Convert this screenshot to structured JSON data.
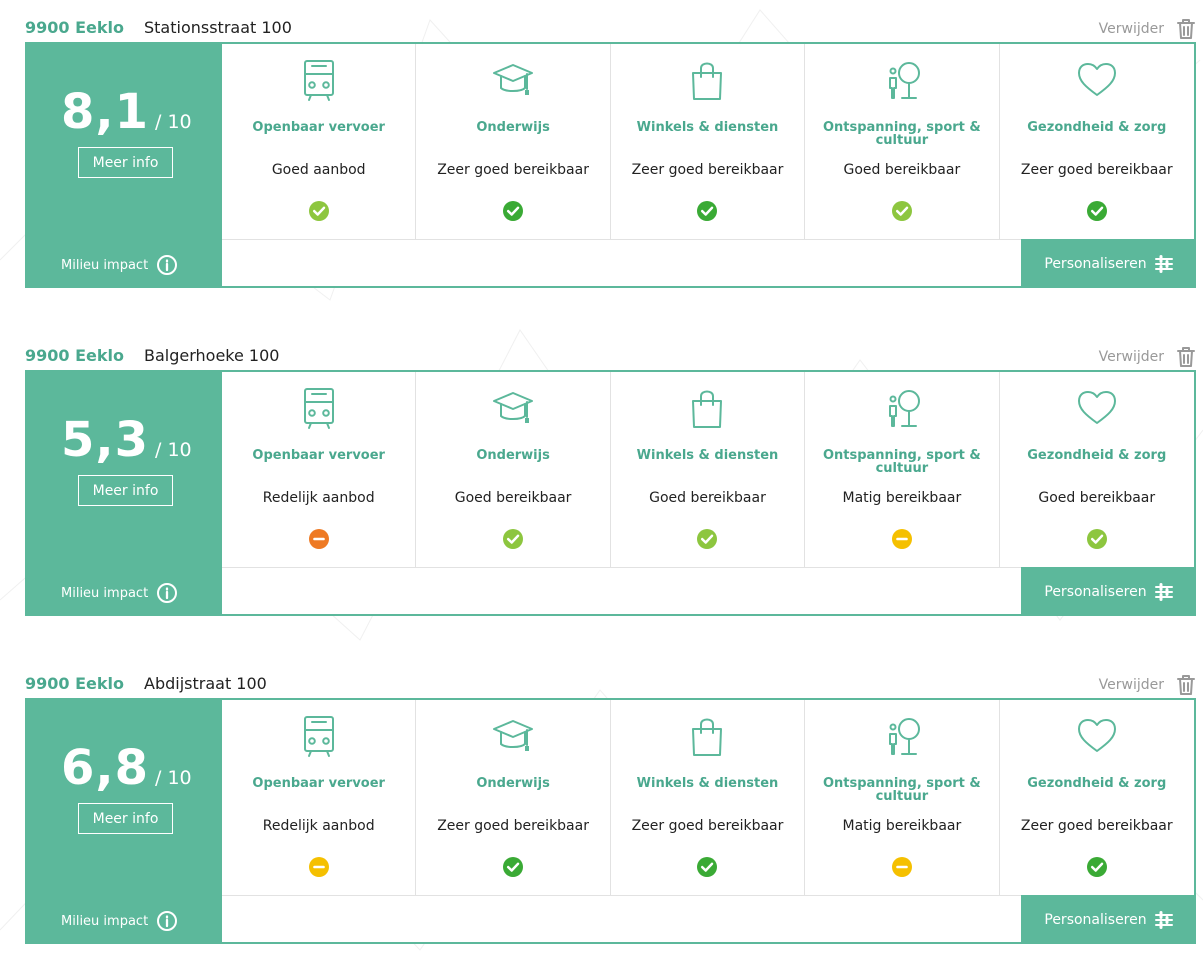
{
  "colors": {
    "brand_green": "#5cb89b",
    "title_green": "#4aa88e",
    "status_good": "#8dc63f",
    "status_very_good": "#3aaa35",
    "status_fair": "#f5c000",
    "status_mixed": "#ee7a24"
  },
  "remove_label": "Verwijder",
  "more_info_label": "Meer info",
  "score_suffix": "/ 10",
  "milieu_label": "Milieu impact",
  "personalize_label": "Personaliseren",
  "category_titles": {
    "transport": "Openbaar vervoer",
    "education": "Onderwijs",
    "shops": "Winkels & diensten",
    "leisure": "Ontspanning, sport & cultuur",
    "health": "Gezondheid & zorg"
  },
  "icons": {
    "transport": "bus-icon",
    "education": "graduation-cap-icon",
    "shops": "shopping-bag-icon",
    "leisure": "park-person-tree-icon",
    "health": "heart-icon",
    "remove": "trash-icon",
    "milieu": "info-icon",
    "personalize": "sliders-icon"
  },
  "cards": [
    {
      "city": "9900 Eeklo",
      "street": "Stationsstraat 100",
      "score": "8,1",
      "categories": [
        {
          "status": "Goed aanbod",
          "badge": "check-good"
        },
        {
          "status": "Zeer goed bereikbaar",
          "badge": "check-very-good"
        },
        {
          "status": "Zeer goed bereikbaar",
          "badge": "check-very-good"
        },
        {
          "status": "Goed bereikbaar",
          "badge": "check-good"
        },
        {
          "status": "Zeer goed bereikbaar",
          "badge": "check-very-good"
        }
      ]
    },
    {
      "city": "9900 Eeklo",
      "street": "Balgerhoeke 100",
      "score": "5,3",
      "categories": [
        {
          "status": "Redelijk aanbod",
          "badge": "minus-orange"
        },
        {
          "status": "Goed bereikbaar",
          "badge": "check-good"
        },
        {
          "status": "Goed bereikbaar",
          "badge": "check-good"
        },
        {
          "status": "Matig bereikbaar",
          "badge": "minus-yellow"
        },
        {
          "status": "Goed bereikbaar",
          "badge": "check-good"
        }
      ]
    },
    {
      "city": "9900 Eeklo",
      "street": "Abdijstraat 100",
      "score": "6,8",
      "categories": [
        {
          "status": "Redelijk aanbod",
          "badge": "minus-yellow"
        },
        {
          "status": "Zeer goed bereikbaar",
          "badge": "check-very-good"
        },
        {
          "status": "Zeer goed bereikbaar",
          "badge": "check-very-good"
        },
        {
          "status": "Matig bereikbaar",
          "badge": "minus-yellow"
        },
        {
          "status": "Zeer goed bereikbaar",
          "badge": "check-very-good"
        }
      ]
    }
  ]
}
